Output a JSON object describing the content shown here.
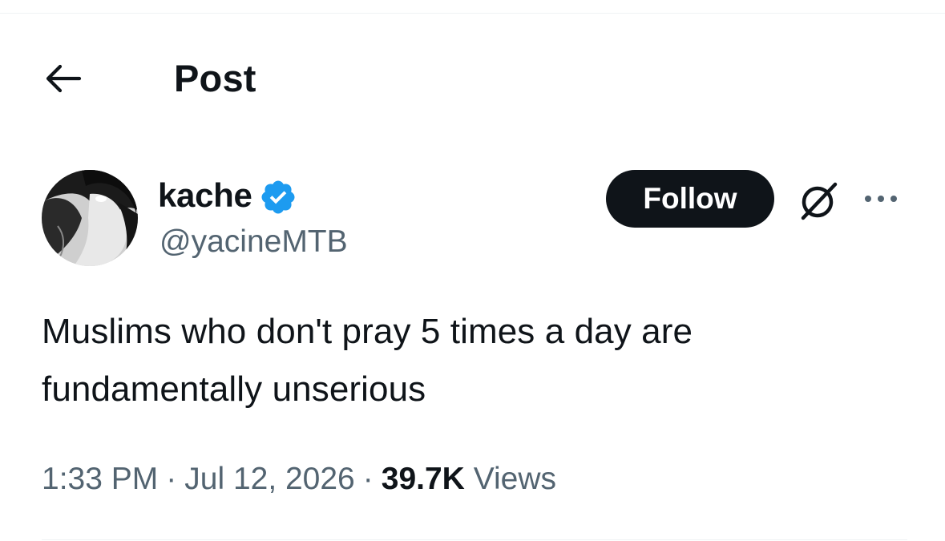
{
  "header": {
    "title": "Post",
    "back_icon": "arrow-left-icon"
  },
  "author": {
    "display_name": "kache",
    "handle": "@yacineMTB",
    "verified": true,
    "verified_color": "#1d9bf0",
    "avatar_icon": "avatar-image",
    "follow_label": "Follow",
    "grok_icon": "grok-icon",
    "more_icon": "more-options-icon"
  },
  "tweet": {
    "text_line1": "Muslims who don't pray 5 times a day are",
    "text_line2": "fundamentally unserious"
  },
  "meta": {
    "time": "1:33 PM",
    "separator": "·",
    "date": "Jul 12, 2026",
    "views_count": "39.7K",
    "views_label": "Views"
  },
  "colors": {
    "text_primary": "#0f1419",
    "text_secondary": "#536471",
    "button_bg": "#0f1419",
    "button_text": "#ffffff",
    "divider": "#eff3f4"
  }
}
